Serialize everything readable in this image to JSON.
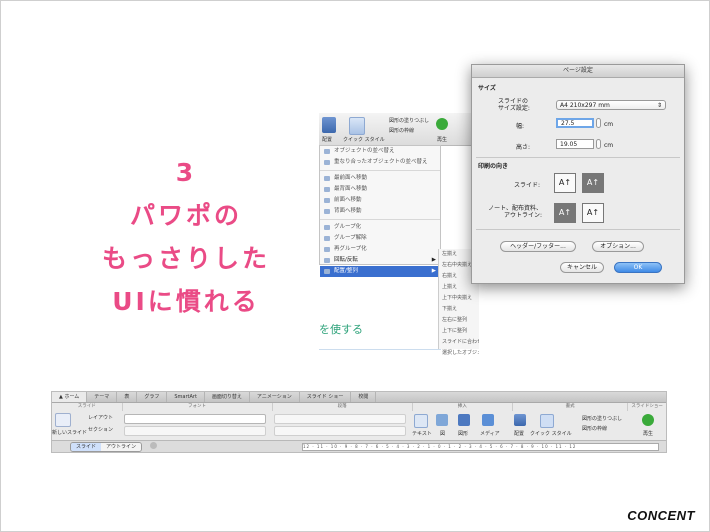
{
  "title_lines": [
    "3",
    "パワポの",
    "もっさりした",
    "UIに慣れる"
  ],
  "logo": "CONCENT",
  "ribbon_crop": {
    "arrange": "配置",
    "quick_style": "クイック スタイル",
    "fill": "図形の塗りつぶし",
    "outline": "図形の枠線",
    "play": "再生"
  },
  "context_menu": {
    "items": [
      "オブジェクトの並べ替え",
      "重なり合ったオブジェクトの並べ替え",
      "最前面へ移動",
      "最背面へ移動",
      "前面へ移動",
      "背面へ移動",
      "グループ化",
      "グループ解除",
      "再グループ化",
      "回転/反転",
      "配置/整列"
    ]
  },
  "submenu": [
    "左揃え",
    "左右中央揃え",
    "右揃え",
    "上揃え",
    "上下中央揃え",
    "下揃え",
    "左右に整列",
    "上下に整列",
    "スライドに合わせて配置",
    "選択したオブジェクトの配置"
  ],
  "slide_fragment": "を使する",
  "dialog": {
    "title": "ページ設定",
    "size_section": "サイズ",
    "size_label": "スライドの\nサイズ設定:",
    "size_value": "A4 210x297 mm",
    "width_label": "幅:",
    "width_value": "27.5",
    "height_label": "高さ:",
    "height_value": "19.05",
    "unit": "cm",
    "orientation_section": "印刷の向き",
    "slide_label": "スライド:",
    "notes_label": "ノート、配布資料、\nアウトライン:",
    "header_footer_button": "ヘッダー/フッター...",
    "options_button": "オプション...",
    "cancel_button": "キャンセル",
    "ok_button": "OK"
  },
  "ribbon": {
    "tabs": [
      "ホーム",
      "テーマ",
      "表",
      "グラフ",
      "SmartArt",
      "画面切り替え",
      "アニメーション",
      "スライド ショー",
      "校閲"
    ],
    "groups": [
      "スライド",
      "フォント",
      "段落",
      "挿入",
      "書式",
      "スライドショー"
    ],
    "new_slide": "新しいスライド",
    "layout": "レイアウト",
    "section": "セクション",
    "text": "テキスト",
    "picture": "図",
    "shape": "図形",
    "media": "メディア",
    "arrange": "配置",
    "quick_style": "クイック スタイル",
    "fill": "図形の塗りつぶし",
    "outline": "図形の枠線",
    "play": "再生",
    "view_slide": "スライド",
    "view_outline": "アウトライン",
    "ruler_text": "12 · 11 · 10 · 9 · 8 · 7 · 6 · 5 · 4 · 3 · 2 · 1 · 0 · 1 · 2 · 3 · 4 · 5 · 6 · 7 · 8 · 9 · 10 · 11 · 12"
  }
}
